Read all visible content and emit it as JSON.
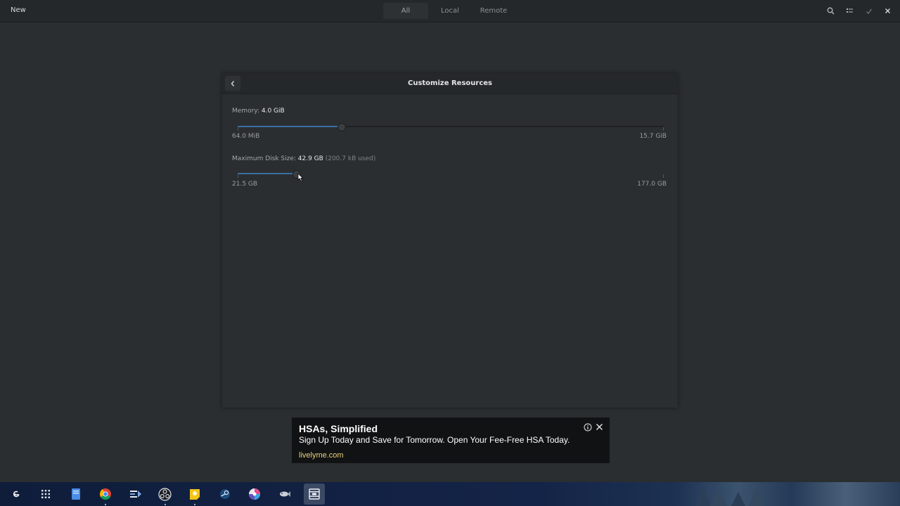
{
  "header": {
    "new_label": "New",
    "tabs": [
      {
        "label": "All",
        "active": true
      },
      {
        "label": "Local",
        "active": false
      },
      {
        "label": "Remote",
        "active": false
      }
    ],
    "icons": [
      "search-icon",
      "selection-mode-icon",
      "checkmark-icon",
      "close-icon"
    ]
  },
  "dialog": {
    "title": "Customize Resources",
    "memory": {
      "label": "Memory:",
      "value": "4.0 GiB",
      "min_label": "64.0 MiB",
      "max_label": "15.7 GiB",
      "level": 0.245
    },
    "disk": {
      "label": "Maximum Disk Size:",
      "value": "42.9 GB",
      "used": "(200.7 kB used)",
      "min_label": "21.5 GB",
      "max_label": "177.0 GB",
      "level": 0.138
    }
  },
  "ad": {
    "title": "HSAs, Simplified",
    "text": "Sign Up Today and Save for Tomorrow. Open Your Fee-Free HSA Today.",
    "url": "livelyme.com"
  },
  "taskbar": {
    "apps": [
      "app-launcher-icon",
      "apps-grid-icon",
      "files-icon",
      "chrome-icon",
      "code-editor-icon",
      "obs-icon",
      "notes-icon",
      "steam-icon",
      "color-picker-icon",
      "aquarium-icon",
      "boxes-icon"
    ]
  },
  "colors": {
    "accent": "#3b6ea5",
    "background": "#2b2e30",
    "header": "#25282a",
    "ad_url": "#e8d27a"
  }
}
